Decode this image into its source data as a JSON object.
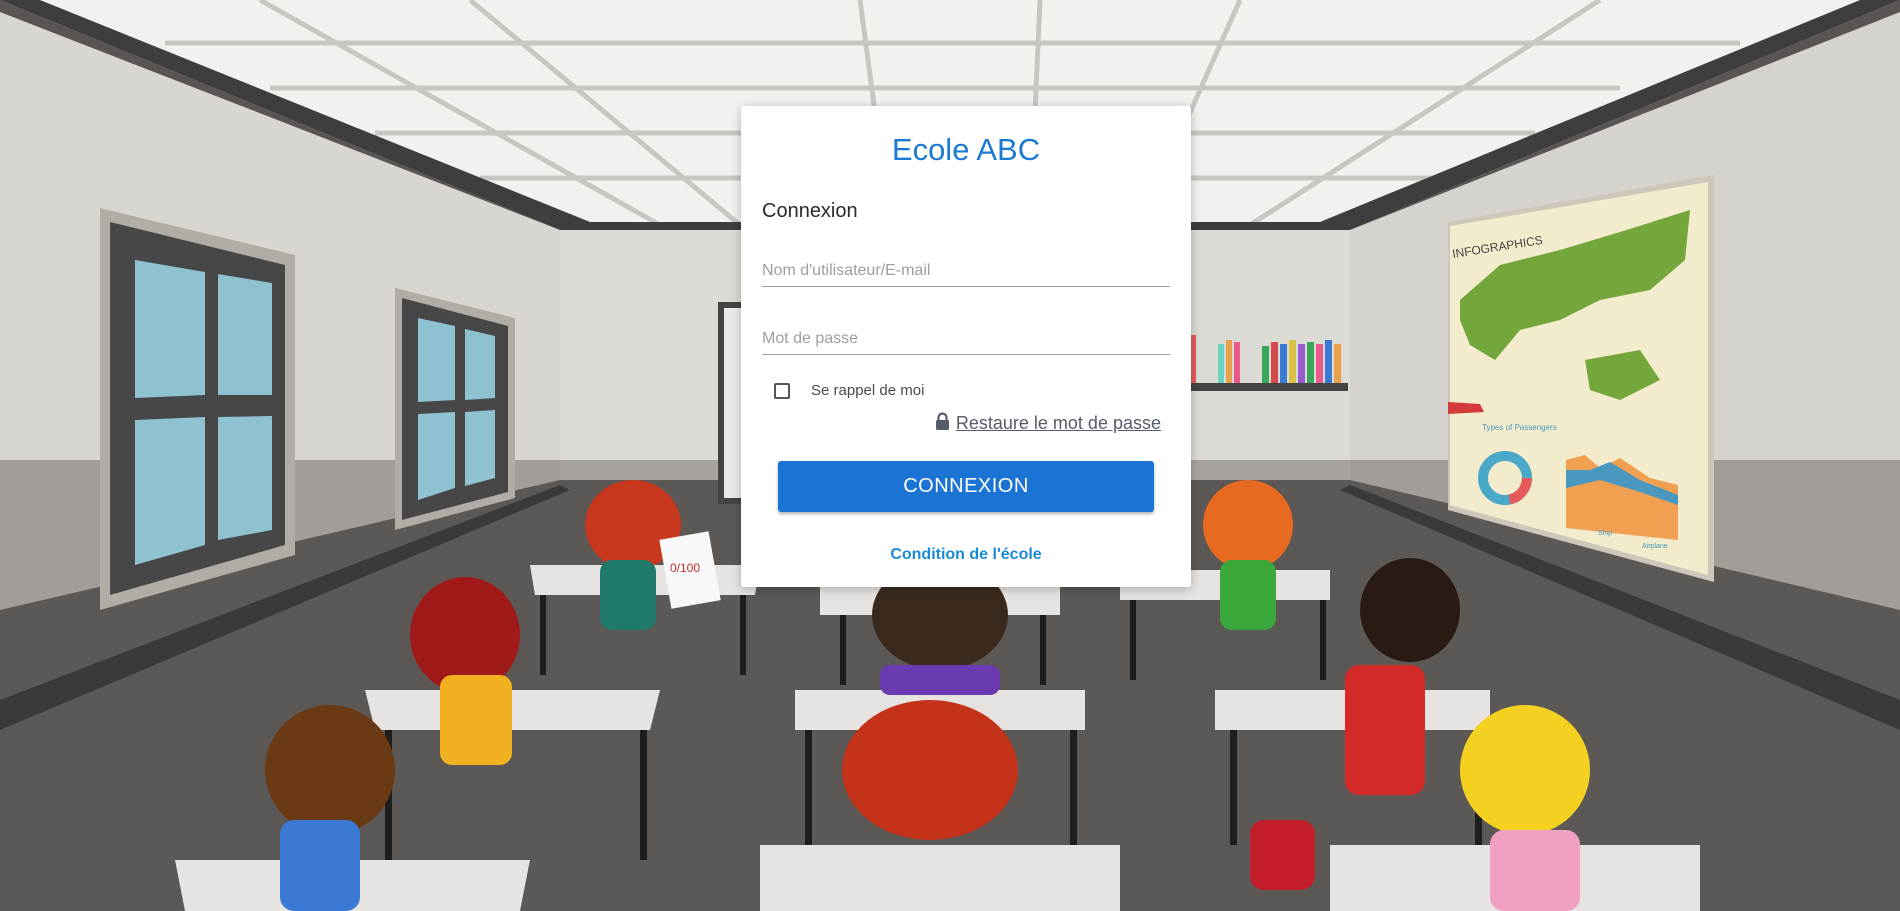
{
  "school_name": "Ecole ABC",
  "form": {
    "heading": "Connexion",
    "username_placeholder": "Nom d'utilisateur/E-mail",
    "password_placeholder": "Mot de passe",
    "remember_label": "Se rappel de moi",
    "remember_checked": false,
    "restore_link": "Restaure le mot de passe",
    "submit_label": "CONNEXION",
    "terms_link": "Condition de l'école"
  },
  "background": {
    "poster_title": "INFOGRAPHICS",
    "poster_chart_label": "Types of Passengers",
    "poster_legend": [
      "Ship",
      "Airplane"
    ],
    "exam_grade": "0/100"
  },
  "colors": {
    "accent": "#1b74d3",
    "title": "#1b7ad2",
    "link": "#1b8ad6"
  }
}
